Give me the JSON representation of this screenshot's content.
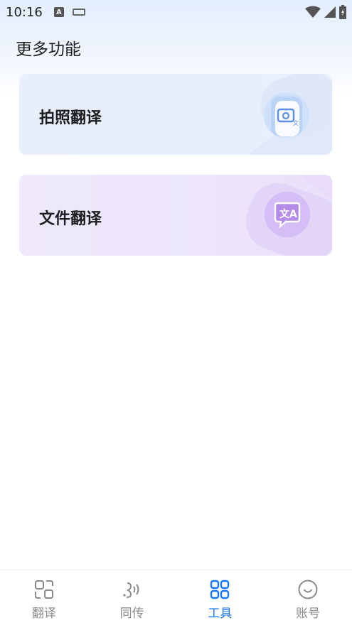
{
  "status_bar": {
    "time": "10:16",
    "icons": [
      "a-notification-icon",
      "keyboard-icon",
      "wifi-icon",
      "signal-icon",
      "battery-icon"
    ]
  },
  "page": {
    "title": "更多功能"
  },
  "cards": [
    {
      "label": "拍照翻译",
      "icon": "camera-translate-icon",
      "color": "#cfe0fb"
    },
    {
      "label": "文件翻译",
      "icon": "file-translate-icon",
      "color": "#d9c6f6"
    }
  ],
  "bottom_nav": {
    "active_color": "#1677ff",
    "inactive_color": "#8a8a8a",
    "items": [
      {
        "label": "翻译",
        "icon": "translate-icon",
        "active": false
      },
      {
        "label": "同传",
        "icon": "voice-wave-icon",
        "active": false
      },
      {
        "label": "工具",
        "icon": "grid-tools-icon",
        "active": true
      },
      {
        "label": "账号",
        "icon": "smiley-account-icon",
        "active": false
      }
    ]
  }
}
